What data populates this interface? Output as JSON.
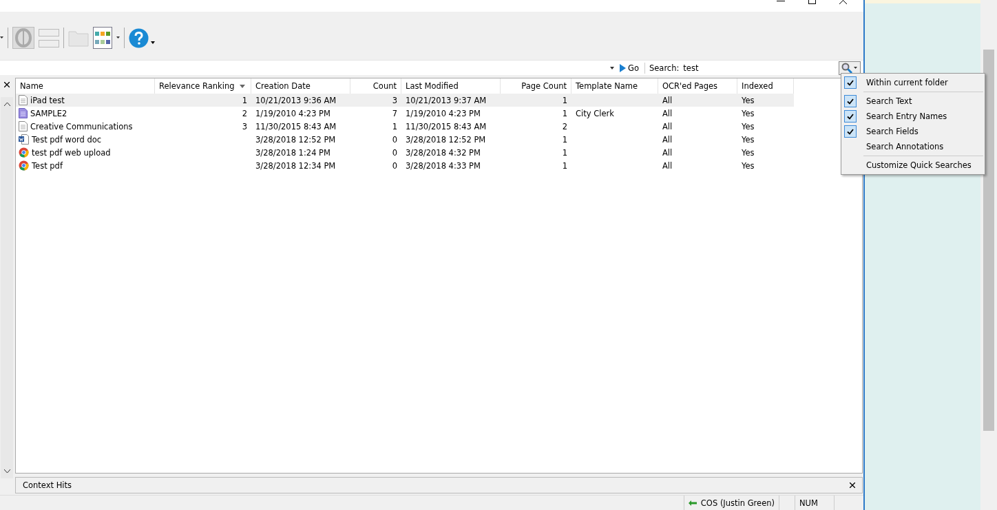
{
  "search_bar": {
    "go_label": "Go",
    "search_label": "Search:",
    "value": "test"
  },
  "table": {
    "columns": [
      {
        "label": "Name",
        "sorted": false
      },
      {
        "label": "Relevance Ranking",
        "sorted": true
      },
      {
        "label": "Creation Date",
        "sorted": false
      },
      {
        "label": "Count",
        "sorted": false
      },
      {
        "label": "Last Modified",
        "sorted": false
      },
      {
        "label": "Page Count",
        "sorted": false
      },
      {
        "label": "Template Name",
        "sorted": false
      },
      {
        "label": "OCR'ed Pages",
        "sorted": false
      },
      {
        "label": "Indexed",
        "sorted": false
      }
    ],
    "rows": [
      {
        "kind": "document",
        "selected": true,
        "cells": [
          "iPad test",
          "1",
          "10/21/2013 9:36 AM",
          "3",
          "10/21/2013 9:37 AM",
          "1",
          "",
          "All",
          "Yes"
        ]
      },
      {
        "kind": "text-document",
        "selected": false,
        "cells": [
          "SAMPLE2",
          "2",
          "1/19/2010 4:23 PM",
          "7",
          "1/19/2010 4:23 PM",
          "1",
          "City Clerk",
          "All",
          "Yes"
        ]
      },
      {
        "kind": "document",
        "selected": false,
        "cells": [
          "Creative Communications",
          "3",
          "11/30/2015 8:43 AM",
          "1",
          "11/30/2015 8:43 AM",
          "2",
          "",
          "All",
          "Yes"
        ]
      },
      {
        "kind": "word",
        "selected": false,
        "cells": [
          "Test pdf word doc",
          "",
          "3/28/2018 12:52 PM",
          "0",
          "3/28/2018 12:52 PM",
          "1",
          "",
          "All",
          "Yes"
        ]
      },
      {
        "kind": "browser",
        "selected": false,
        "cells": [
          "test pdf web upload",
          "",
          "3/28/2018 1:24 PM",
          "0",
          "3/28/2018 4:32 PM",
          "1",
          "",
          "All",
          "Yes"
        ]
      },
      {
        "kind": "browser",
        "selected": false,
        "cells": [
          "Test pdf",
          "",
          "3/28/2018 12:34 PM",
          "0",
          "3/28/2018 4:33 PM",
          "1",
          "",
          "All",
          "Yes"
        ]
      }
    ]
  },
  "search_menu": {
    "groups": [
      [
        {
          "label": "Within current folder",
          "checked": true
        }
      ],
      [
        {
          "label": "Search Text",
          "checked": true
        },
        {
          "label": "Search Entry Names",
          "checked": true
        },
        {
          "label": "Search Fields",
          "checked": true
        },
        {
          "label": "Search Annotations",
          "checked": false
        }
      ],
      [
        {
          "label": "Customize Quick Searches",
          "checked": false
        }
      ]
    ]
  },
  "context_panel": {
    "title": "Context Hits"
  },
  "status_bar": {
    "user": "COS (Justin Green)",
    "num": "NUM"
  }
}
